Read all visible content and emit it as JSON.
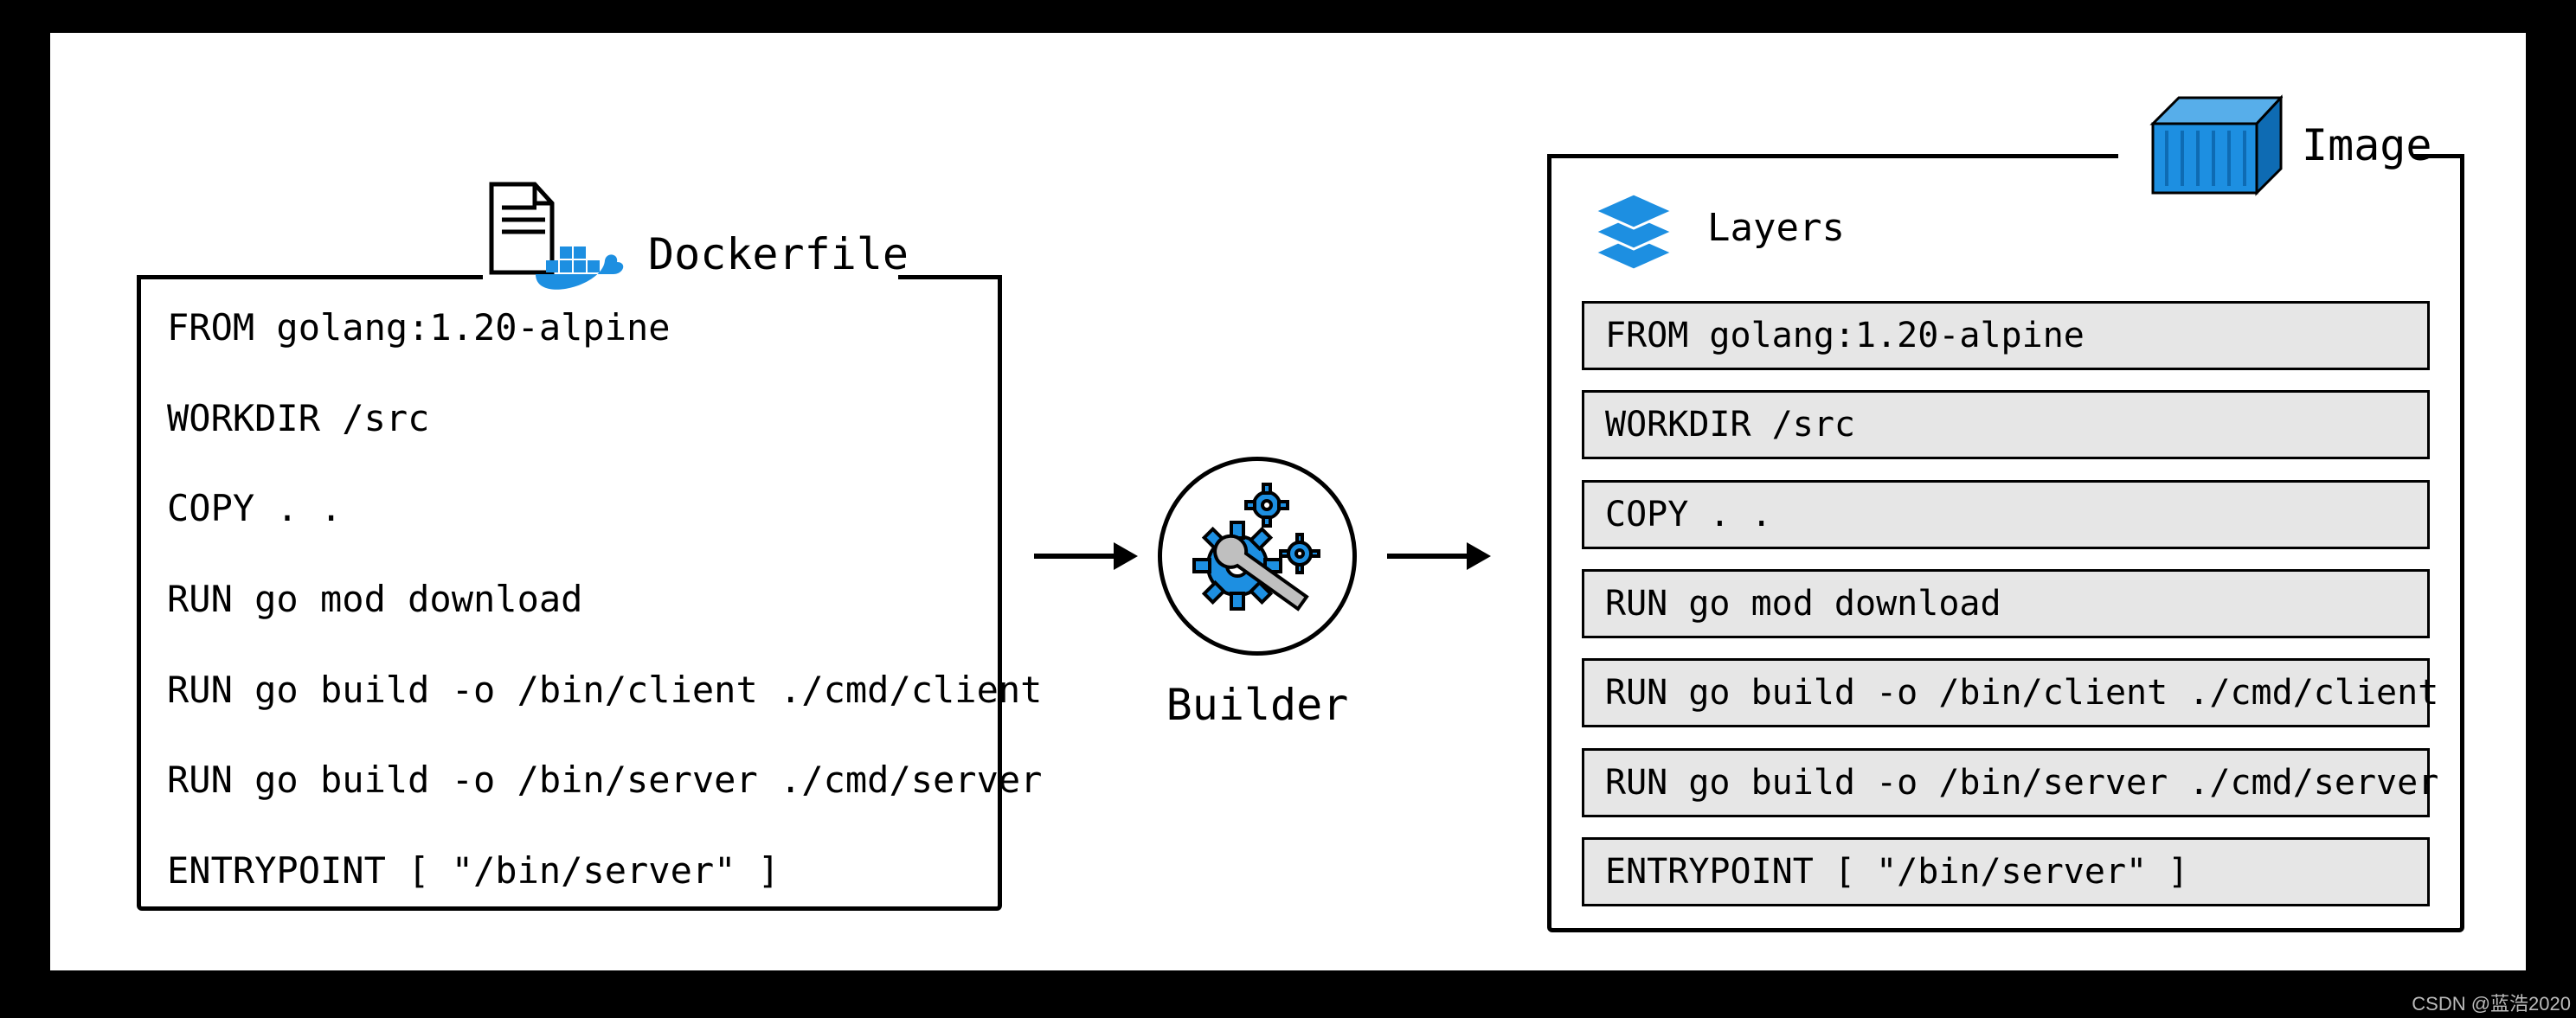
{
  "dockerfile": {
    "title": "Dockerfile",
    "lines": [
      "FROM golang:1.20-alpine",
      "WORKDIR /src",
      "COPY . .",
      "RUN go mod download",
      "RUN go build -o /bin/client ./cmd/client",
      "RUN go build -o /bin/server ./cmd/server",
      "ENTRYPOINT [ \"/bin/server\" ]"
    ]
  },
  "builder": {
    "label": "Builder"
  },
  "image": {
    "title": "Image",
    "layers_label": "Layers",
    "layers": [
      "FROM golang:1.20-alpine",
      "WORKDIR /src",
      "COPY . .",
      "RUN go mod download",
      "RUN go build -o /bin/client ./cmd/client",
      "RUN go build -o /bin/server ./cmd/server",
      "ENTRYPOINT [ \"/bin/server\" ]"
    ]
  },
  "colors": {
    "accent": "#1d8fe1",
    "layer_bg": "#e6e6e6"
  },
  "watermark": "CSDN @蓝浩2020"
}
